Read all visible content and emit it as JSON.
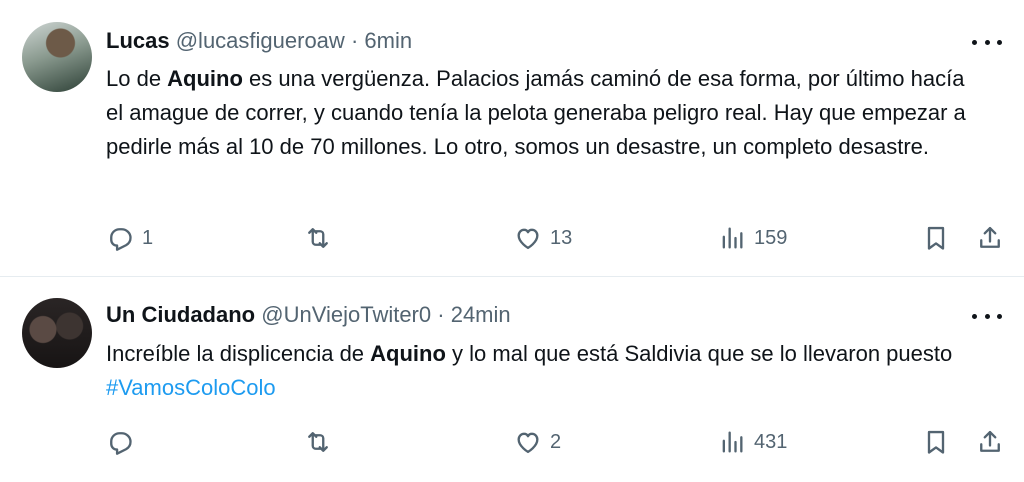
{
  "tweets": [
    {
      "name": "Lucas",
      "handle": "@lucasfigueroaw",
      "separator": "·",
      "time": "6min",
      "text_parts": [
        "Lo de ",
        "Aquino",
        " es una vergüenza. Palacios jamás caminó de esa forma, por último hacía el amague de correr, y cuando tenía la pelota generaba peligro real. Hay que empezar a pedirle más al 10 de 70 millones. Lo otro, somos un desastre, un completo desastre."
      ],
      "replies": "1",
      "retweets": "",
      "likes": "13",
      "views": "159"
    },
    {
      "name": "Un Ciudadano",
      "handle": "@UnViejoTwiter0",
      "separator": "·",
      "time": "24min",
      "text_parts": [
        "Increíble la displicencia de ",
        "Aquino",
        " y lo mal que está Saldivia que se lo llevaron puesto  ",
        "#VamosColoColo"
      ],
      "replies": "",
      "retweets": "",
      "likes": "2",
      "views": "431"
    }
  ],
  "icons": {
    "reply": "reply-icon",
    "retweet": "retweet-icon",
    "like": "heart-icon",
    "views": "views-icon",
    "bookmark": "bookmark-icon",
    "share": "share-icon",
    "more": "more-icon"
  },
  "colors": {
    "text": "#0f1419",
    "secondary": "#536471",
    "hashtag": "#1d9bf0",
    "divider": "#e6ecf0"
  }
}
